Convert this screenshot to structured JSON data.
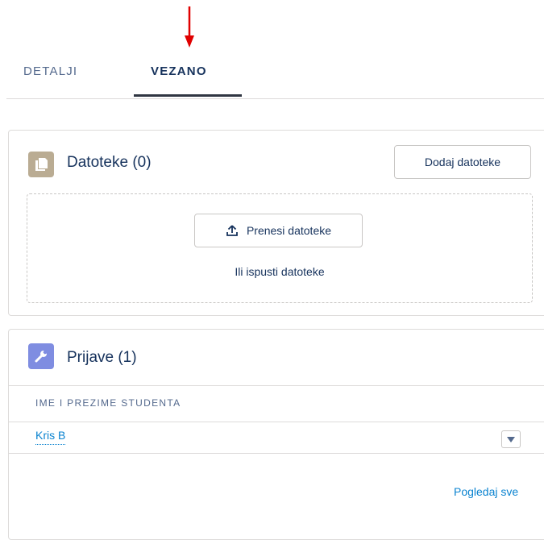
{
  "colors": {
    "annotation_arrow": "#e00000",
    "files_icon_bg": "#baac93",
    "wrench_icon_bg": "#7f8de1",
    "link": "#0a83d0"
  },
  "tabs": [
    {
      "label": "DETALJI",
      "active": false
    },
    {
      "label": "VEZANO",
      "active": true
    }
  ],
  "files_card": {
    "icon": "file-icon",
    "title": "Datoteke (0)",
    "add_button_label": "Dodaj datoteke",
    "upload_button_label": "Prenesi datoteke",
    "upload_icon": "upload-icon",
    "drop_hint": "Ili ispusti datoteke"
  },
  "prijave_card": {
    "icon": "wrench-icon",
    "title": "Prijave (1)",
    "column_header": "IME I PREZIME STUDENTA",
    "rows": [
      {
        "name": "Kris B"
      }
    ],
    "row_menu_icon": "chevron-down-icon",
    "view_all_label": "Pogledaj sve"
  }
}
